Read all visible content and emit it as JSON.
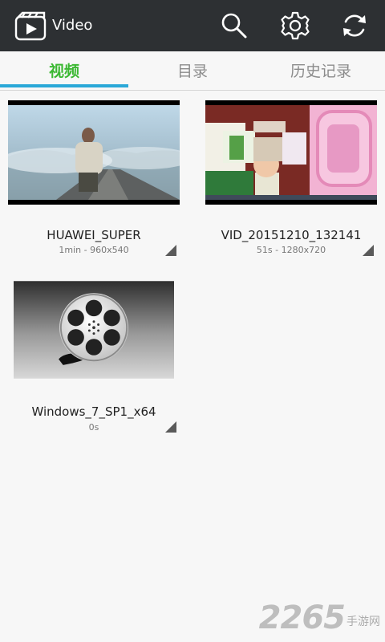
{
  "header": {
    "app_icon": "clapperboard-play-icon",
    "title": "Video",
    "actions": [
      {
        "icon": "search-icon"
      },
      {
        "icon": "gear-icon"
      },
      {
        "icon": "refresh-icon"
      }
    ]
  },
  "tabs": [
    {
      "label": "视频",
      "selected": true
    },
    {
      "label": "目录",
      "selected": false
    },
    {
      "label": "历史记录",
      "selected": false
    }
  ],
  "videos": [
    {
      "title": "HUAWEI_SUPER",
      "meta": "1min - 960x540"
    },
    {
      "title": "VID_20151210_132141",
      "meta": "51s - 1280x720"
    },
    {
      "title": "Windows_7_SP1_x64",
      "meta": "0s"
    }
  ],
  "watermark": {
    "number": "2265",
    "text": "手游网"
  },
  "colors": {
    "topbar": "#2d3033",
    "accent_green": "#3bb832",
    "indicator_blue": "#2aa8d8",
    "background": "#f7f7f7"
  }
}
